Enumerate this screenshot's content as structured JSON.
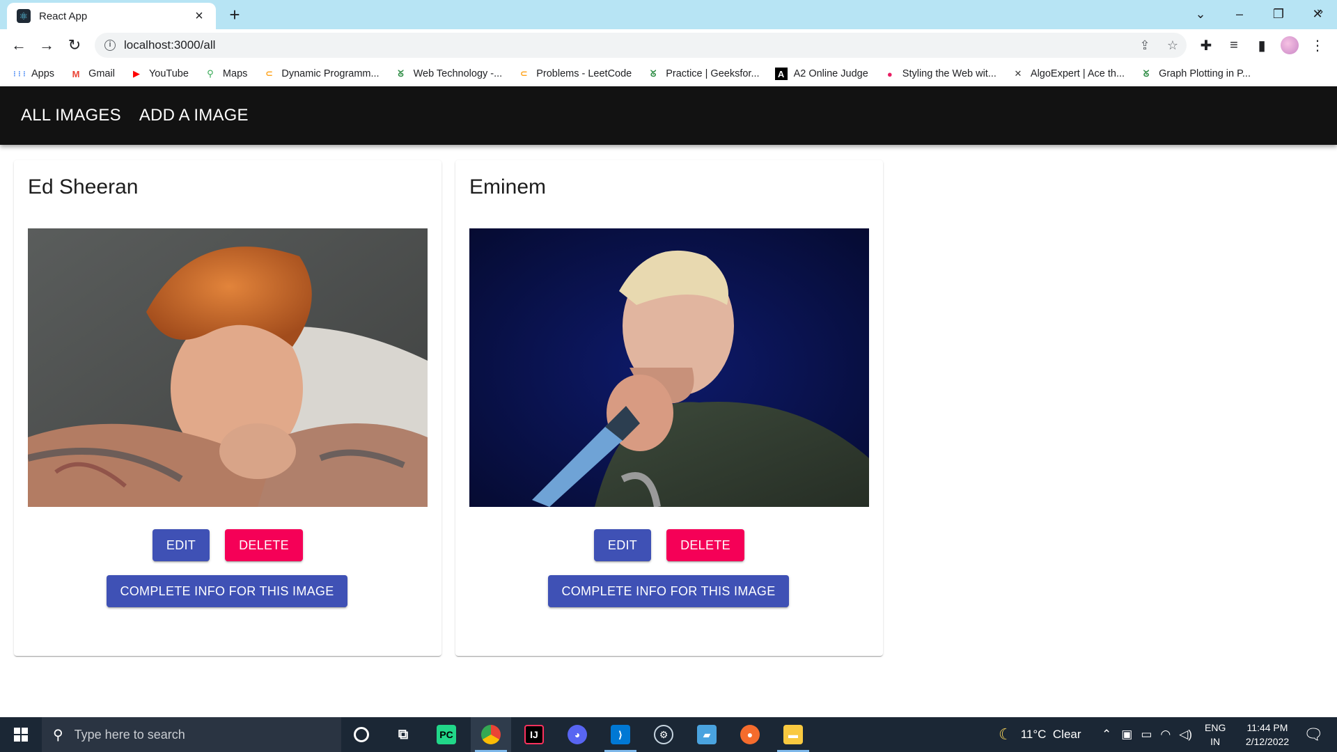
{
  "browser": {
    "tab_title": "React App",
    "url": "localhost:3000/all",
    "bookmarks": [
      {
        "label": "Apps",
        "icon": "apps-grid-icon",
        "color": "#4285f4"
      },
      {
        "label": "Gmail",
        "icon": "gmail-icon",
        "color": "#ea4335"
      },
      {
        "label": "YouTube",
        "icon": "youtube-icon",
        "color": "#ff0000"
      },
      {
        "label": "Maps",
        "icon": "maps-icon",
        "color": "#34a853"
      },
      {
        "label": "Dynamic Programm...",
        "icon": "leetcode-icon",
        "color": "#ffa116"
      },
      {
        "label": "Web Technology -...",
        "icon": "geeksforgeeks-icon",
        "color": "#2f8d46"
      },
      {
        "label": "Problems - LeetCode",
        "icon": "leetcode-icon",
        "color": "#ffa116"
      },
      {
        "label": "Practice | Geeksfor...",
        "icon": "geeksforgeeks-icon",
        "color": "#2f8d46"
      },
      {
        "label": "A2 Online Judge",
        "icon": "a2-icon",
        "color": "#000000"
      },
      {
        "label": "Styling the Web wit...",
        "icon": "styling-icon",
        "color": "#e91e63"
      },
      {
        "label": "AlgoExpert | Ace th...",
        "icon": "algoexpert-icon",
        "color": "#3a3a3a"
      },
      {
        "label": "Graph Plotting in P...",
        "icon": "geeksforgeeks-icon",
        "color": "#2f8d46"
      }
    ]
  },
  "nav": {
    "all_images": "ALL IMAGES",
    "add_image": "ADD A IMAGE"
  },
  "cards": [
    {
      "title": "Ed Sheeran",
      "edit_label": "EDIT",
      "delete_label": "DELETE",
      "info_label": "COMPLETE INFO FOR THIS IMAGE"
    },
    {
      "title": "Eminem",
      "edit_label": "EDIT",
      "delete_label": "DELETE",
      "info_label": "COMPLETE INFO FOR THIS IMAGE"
    }
  ],
  "taskbar": {
    "search_placeholder": "Type here to search",
    "weather": "11°C  Clear",
    "lang_top": "ENG",
    "lang_bottom": "IN",
    "time": "11:44 PM",
    "date": "2/12/2022"
  },
  "colors": {
    "primary": "#3f51b5",
    "secondary": "#f50057",
    "appbar": "#121212",
    "tabstrip": "#b7e4f4"
  }
}
